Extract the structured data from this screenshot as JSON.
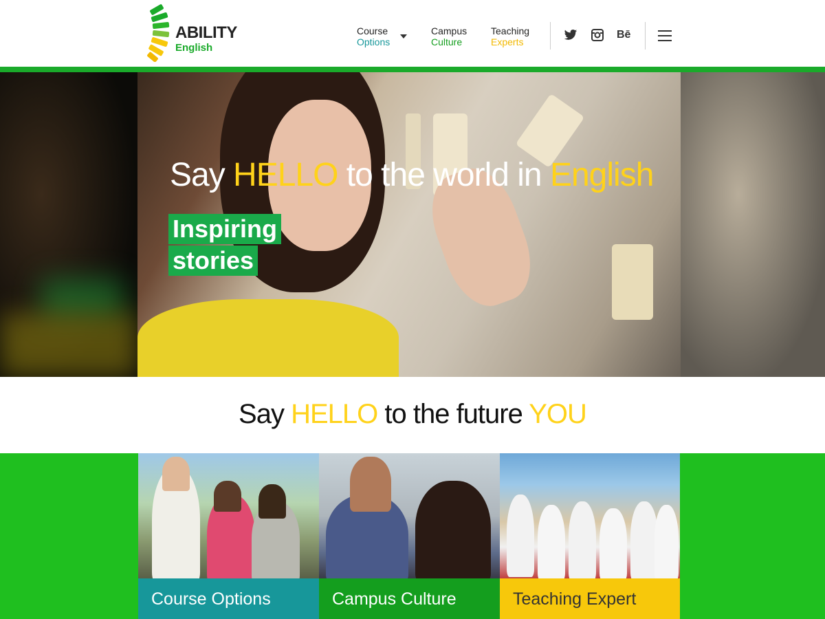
{
  "brand": {
    "name": "ABILITY",
    "subname": "English"
  },
  "nav": {
    "items": [
      {
        "line1": "Course",
        "line2": "Options",
        "color": "#17979a"
      },
      {
        "line1": "Campus",
        "line2": "Culture",
        "color": "#149e1e"
      },
      {
        "line1": "Teaching",
        "line2": "Experts",
        "color": "#f2b800"
      }
    ],
    "social": [
      "twitter-icon",
      "instagram-icon",
      "behance-icon"
    ],
    "behance_label": "Bē"
  },
  "hero": {
    "headline_parts": [
      "Say ",
      "HELLO",
      " to the world in ",
      "English"
    ],
    "tags": [
      "Inspiring",
      "stories"
    ]
  },
  "tagline": {
    "parts": [
      "Say ",
      "HELLO",
      " to the future ",
      "YOU"
    ]
  },
  "cards": [
    {
      "label": "Course Options",
      "color": "#17979a"
    },
    {
      "label": "Campus Culture",
      "color": "#149e1e"
    },
    {
      "label": "Teaching Expert",
      "color": "#f7c80b"
    }
  ],
  "colors": {
    "green": "#1aaa2a",
    "yellow": "#ffd21a",
    "teal": "#17979a"
  }
}
